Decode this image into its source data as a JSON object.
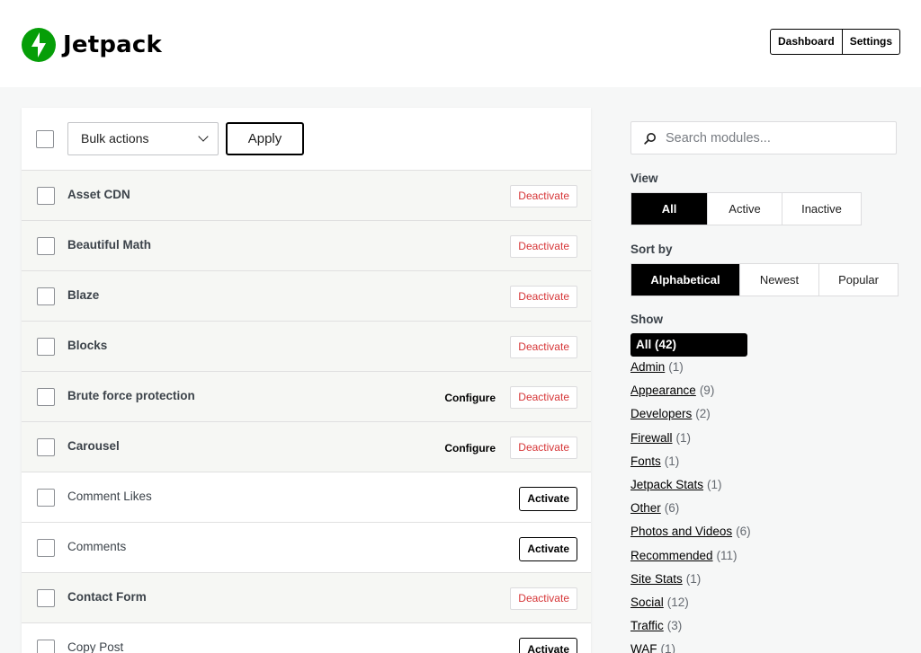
{
  "header": {
    "brand": "Jetpack",
    "buttons": [
      "Dashboard",
      "Settings"
    ]
  },
  "colors": {
    "brand_green": "#069e08",
    "deactivate_red": "#d63638",
    "active_row_bg": "#f6f7f4"
  },
  "toolbar": {
    "bulk_select_value": "Bulk actions",
    "apply_label": "Apply"
  },
  "modules": [
    {
      "name": "Asset CDN",
      "active": true,
      "configure": "",
      "action": "Deactivate"
    },
    {
      "name": "Beautiful Math",
      "active": true,
      "configure": "",
      "action": "Deactivate"
    },
    {
      "name": "Blaze",
      "active": true,
      "configure": "",
      "action": "Deactivate"
    },
    {
      "name": "Blocks",
      "active": true,
      "configure": "",
      "action": "Deactivate"
    },
    {
      "name": "Brute force protection",
      "active": true,
      "configure": "Configure",
      "action": "Deactivate"
    },
    {
      "name": "Carousel",
      "active": true,
      "configure": "Configure",
      "action": "Deactivate"
    },
    {
      "name": "Comment Likes",
      "active": false,
      "configure": "",
      "action": "Activate"
    },
    {
      "name": "Comments",
      "active": false,
      "configure": "",
      "action": "Activate"
    },
    {
      "name": "Contact Form",
      "active": true,
      "configure": "",
      "action": "Deactivate"
    },
    {
      "name": "Copy Post",
      "active": false,
      "configure": "",
      "action": "Activate"
    }
  ],
  "sidebar": {
    "search_placeholder": "Search modules...",
    "view_label": "View",
    "view_options": [
      "All",
      "Active",
      "Inactive"
    ],
    "view_selected": "All",
    "sort_label": "Sort by",
    "sort_options": [
      "Alphabetical",
      "Newest",
      "Popular"
    ],
    "sort_selected": "Alphabetical",
    "show_label": "Show",
    "show_all": "All (42)",
    "show_items": [
      {
        "label": "Admin",
        "count": "(1)"
      },
      {
        "label": "Appearance",
        "count": "(9)"
      },
      {
        "label": "Developers",
        "count": "(2)"
      },
      {
        "label": "Firewall",
        "count": "(1)"
      },
      {
        "label": "Fonts",
        "count": "(1)"
      },
      {
        "label": "Jetpack Stats",
        "count": "(1)"
      },
      {
        "label": "Other",
        "count": "(6)"
      },
      {
        "label": "Photos and Videos",
        "count": "(6)"
      },
      {
        "label": "Recommended",
        "count": "(11)"
      },
      {
        "label": "Site Stats",
        "count": "(1)"
      },
      {
        "label": "Social",
        "count": "(12)"
      },
      {
        "label": "Traffic",
        "count": "(3)"
      },
      {
        "label": "WAF",
        "count": "(1)"
      }
    ]
  }
}
